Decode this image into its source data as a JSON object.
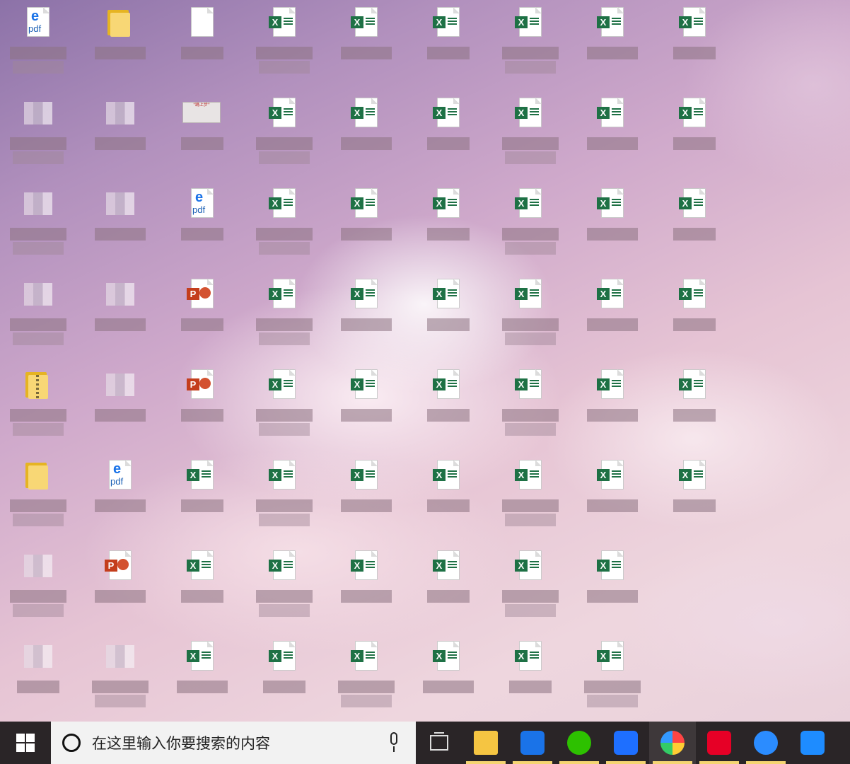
{
  "desktop": {
    "columns": 9,
    "icons": [
      {
        "row": 0,
        "col": 0,
        "type": "pdf"
      },
      {
        "row": 0,
        "col": 1,
        "type": "folder"
      },
      {
        "row": 0,
        "col": 2,
        "type": "blank"
      },
      {
        "row": 0,
        "col": 3,
        "type": "excel"
      },
      {
        "row": 0,
        "col": 4,
        "type": "excel"
      },
      {
        "row": 0,
        "col": 5,
        "type": "excel"
      },
      {
        "row": 0,
        "col": 6,
        "type": "excel"
      },
      {
        "row": 0,
        "col": 7,
        "type": "excel"
      },
      {
        "row": 0,
        "col": 8,
        "type": "excel"
      },
      {
        "row": 1,
        "col": 0,
        "type": "blurred"
      },
      {
        "row": 1,
        "col": 1,
        "type": "blurred"
      },
      {
        "row": 1,
        "col": 2,
        "type": "image"
      },
      {
        "row": 1,
        "col": 3,
        "type": "excel"
      },
      {
        "row": 1,
        "col": 4,
        "type": "excel"
      },
      {
        "row": 1,
        "col": 5,
        "type": "excel"
      },
      {
        "row": 1,
        "col": 6,
        "type": "excel"
      },
      {
        "row": 1,
        "col": 7,
        "type": "excel"
      },
      {
        "row": 1,
        "col": 8,
        "type": "excel"
      },
      {
        "row": 2,
        "col": 0,
        "type": "blurred"
      },
      {
        "row": 2,
        "col": 1,
        "type": "blurred"
      },
      {
        "row": 2,
        "col": 2,
        "type": "pdf"
      },
      {
        "row": 2,
        "col": 3,
        "type": "excel"
      },
      {
        "row": 2,
        "col": 4,
        "type": "excel"
      },
      {
        "row": 2,
        "col": 5,
        "type": "excel"
      },
      {
        "row": 2,
        "col": 6,
        "type": "excel"
      },
      {
        "row": 2,
        "col": 7,
        "type": "excel"
      },
      {
        "row": 2,
        "col": 8,
        "type": "excel"
      },
      {
        "row": 3,
        "col": 0,
        "type": "blurred"
      },
      {
        "row": 3,
        "col": 1,
        "type": "blurred"
      },
      {
        "row": 3,
        "col": 2,
        "type": "ppt"
      },
      {
        "row": 3,
        "col": 3,
        "type": "excel"
      },
      {
        "row": 3,
        "col": 4,
        "type": "excel"
      },
      {
        "row": 3,
        "col": 5,
        "type": "excel"
      },
      {
        "row": 3,
        "col": 6,
        "type": "excel"
      },
      {
        "row": 3,
        "col": 7,
        "type": "excel"
      },
      {
        "row": 3,
        "col": 8,
        "type": "excel"
      },
      {
        "row": 4,
        "col": 0,
        "type": "zip"
      },
      {
        "row": 4,
        "col": 1,
        "type": "blurred"
      },
      {
        "row": 4,
        "col": 2,
        "type": "ppt"
      },
      {
        "row": 4,
        "col": 3,
        "type": "excel"
      },
      {
        "row": 4,
        "col": 4,
        "type": "excel"
      },
      {
        "row": 4,
        "col": 5,
        "type": "excel"
      },
      {
        "row": 4,
        "col": 6,
        "type": "excel"
      },
      {
        "row": 4,
        "col": 7,
        "type": "excel"
      },
      {
        "row": 4,
        "col": 8,
        "type": "excel"
      },
      {
        "row": 5,
        "col": 0,
        "type": "folder"
      },
      {
        "row": 5,
        "col": 1,
        "type": "pdf"
      },
      {
        "row": 5,
        "col": 2,
        "type": "excel"
      },
      {
        "row": 5,
        "col": 3,
        "type": "excel"
      },
      {
        "row": 5,
        "col": 4,
        "type": "excel"
      },
      {
        "row": 5,
        "col": 5,
        "type": "excel"
      },
      {
        "row": 5,
        "col": 6,
        "type": "excel"
      },
      {
        "row": 5,
        "col": 7,
        "type": "excel"
      },
      {
        "row": 5,
        "col": 8,
        "type": "excel"
      },
      {
        "row": 6,
        "col": 0,
        "type": "blurred"
      },
      {
        "row": 6,
        "col": 1,
        "type": "ppt"
      },
      {
        "row": 6,
        "col": 2,
        "type": "excel"
      },
      {
        "row": 6,
        "col": 3,
        "type": "excel"
      },
      {
        "row": 6,
        "col": 4,
        "type": "excel"
      },
      {
        "row": 6,
        "col": 5,
        "type": "excel"
      },
      {
        "row": 6,
        "col": 6,
        "type": "excel"
      },
      {
        "row": 6,
        "col": 7,
        "type": "excel"
      },
      {
        "row": 7,
        "col": 0,
        "type": "blurred"
      },
      {
        "row": 7,
        "col": 1,
        "type": "blurred"
      },
      {
        "row": 7,
        "col": 2,
        "type": "excel"
      },
      {
        "row": 7,
        "col": 3,
        "type": "excel"
      },
      {
        "row": 7,
        "col": 4,
        "type": "excel"
      },
      {
        "row": 7,
        "col": 5,
        "type": "excel"
      },
      {
        "row": 7,
        "col": 6,
        "type": "excel"
      },
      {
        "row": 7,
        "col": 7,
        "type": "excel"
      }
    ],
    "glyphs": {
      "excel_letter": "X",
      "ppt_letter": "P",
      "pdf_letter": "e",
      "pdf_text": "pdf",
      "image_caption": "\"踊上步\""
    }
  },
  "taskbar": {
    "search_placeholder": "在这里输入你要搜索的内容",
    "apps": [
      {
        "name": "file-explorer",
        "icon": "folder-icon",
        "color": "#f5c542",
        "running": true
      },
      {
        "name": "edge",
        "icon": "edge-icon",
        "color": "#1a73e8",
        "running": true
      },
      {
        "name": "wechat",
        "icon": "wechat-icon",
        "color": "#2dc100",
        "running": true
      },
      {
        "name": "tencent-meeting",
        "icon": "meeting-icon",
        "color": "#1e6fff",
        "running": true
      },
      {
        "name": "colorful-app",
        "icon": "pinwheel-icon",
        "color": "#e94e77",
        "running": true,
        "active": true
      },
      {
        "name": "netease-music",
        "icon": "music-icon",
        "color": "#e60026",
        "running": true
      },
      {
        "name": "qq-browser",
        "icon": "qq-browser-icon",
        "color": "#2b8cff",
        "running": true
      },
      {
        "name": "notes",
        "icon": "pen-icon",
        "color": "#1e8cff",
        "running": false
      }
    ]
  },
  "colors": {
    "excel": "#1e7145",
    "ppt": "#c43e1c",
    "taskbar": "#2a2527",
    "running_indicator": "#f5d572"
  }
}
